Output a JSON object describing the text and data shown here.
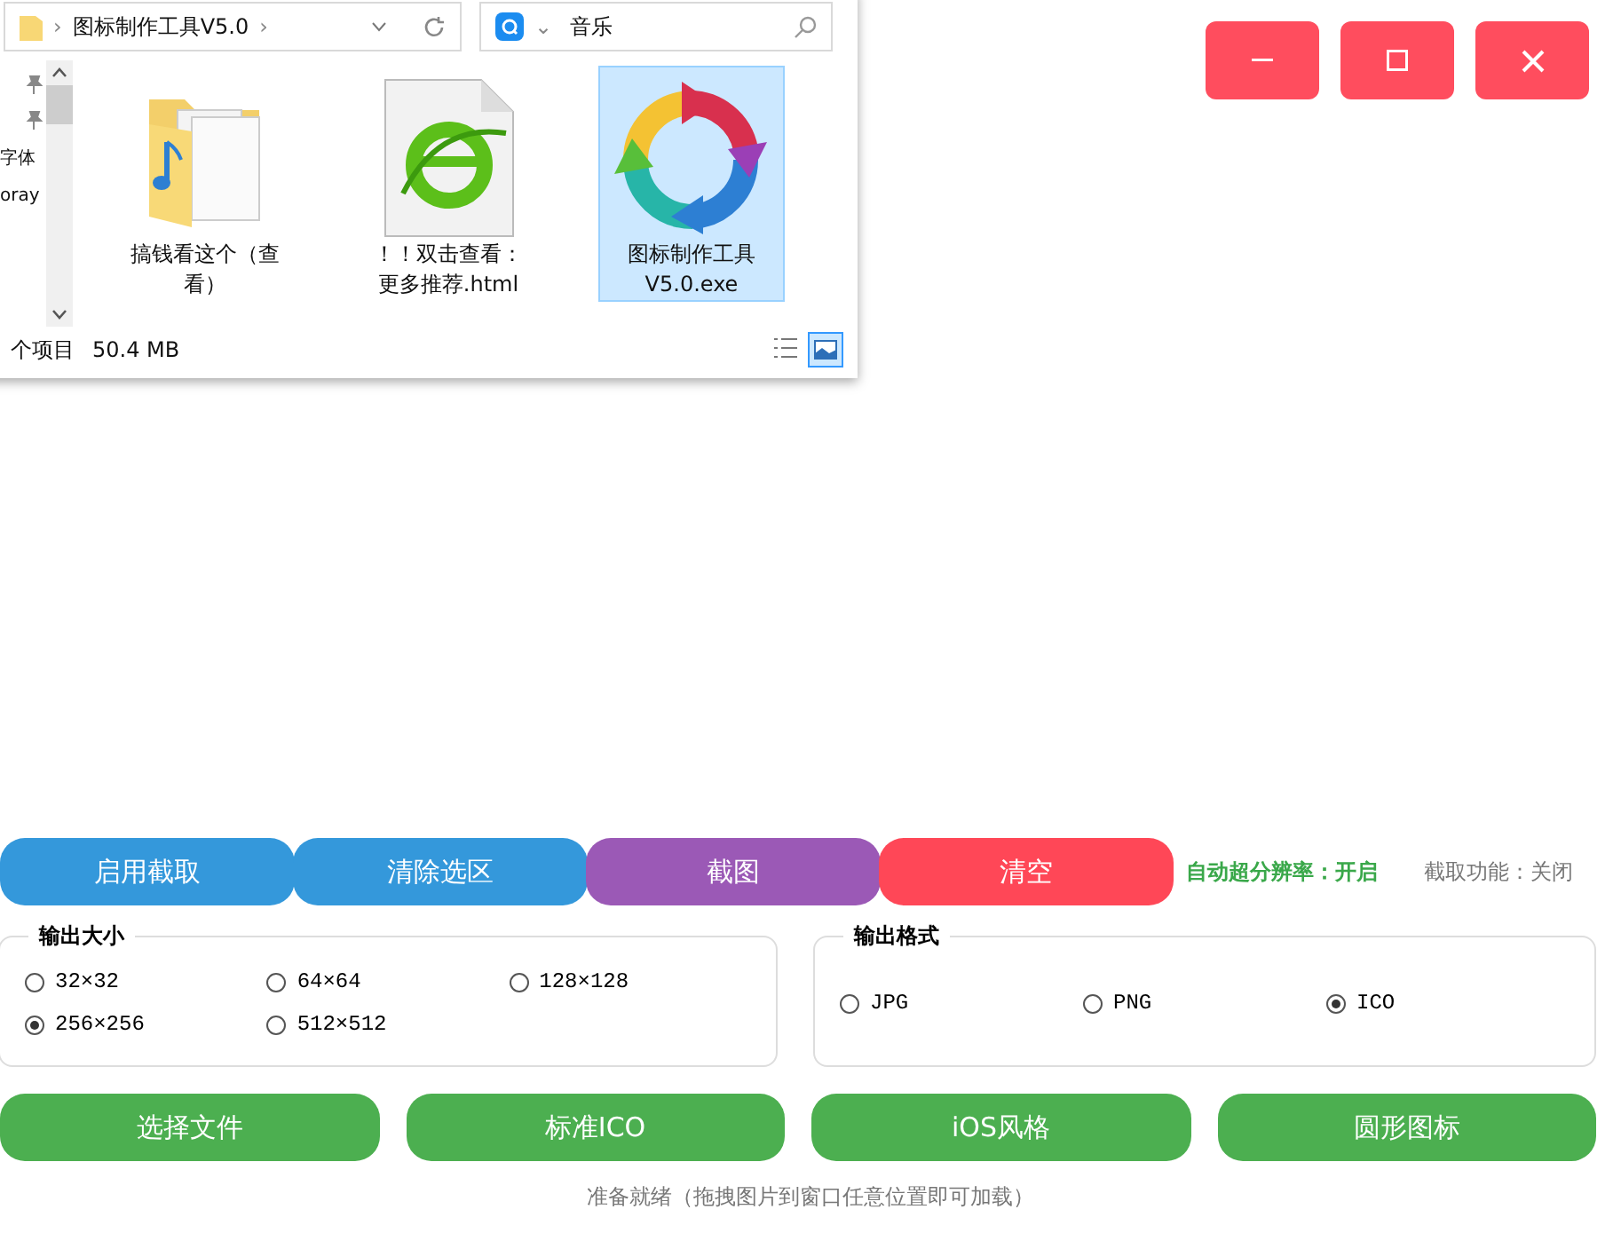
{
  "explorer": {
    "address": {
      "path": "图标制作工具V5.0",
      "separator_before": "›",
      "separator_after": "›"
    },
    "search": {
      "value": "音乐",
      "caret": "⌄"
    },
    "nav_items": [
      {
        "kind": "pin"
      },
      {
        "kind": "pin"
      },
      {
        "kind": "text",
        "label": "字体"
      },
      {
        "kind": "text",
        "label": "oray"
      }
    ],
    "files": [
      {
        "kind": "music-folder",
        "name": "搞钱看这个（查看）",
        "selected": false
      },
      {
        "kind": "web-page",
        "name": "！！双击查看：更多推荐.html",
        "selected": false
      },
      {
        "kind": "program",
        "name": "图标制作工具V5.0.exe",
        "selected": true
      }
    ],
    "status_bar": {
      "count": "个项目",
      "size": "50.4 MB"
    }
  },
  "window_controls": [
    {
      "kind": "minimize"
    },
    {
      "kind": "maximize"
    },
    {
      "kind": "close"
    }
  ],
  "toolbar": {
    "buttons": [
      {
        "label": "启用截取",
        "color": "#3498db"
      },
      {
        "label": "清除选区",
        "color": "#3498db"
      },
      {
        "label": "截图",
        "color": "#9b59b6"
      },
      {
        "label": "清空",
        "color": "#ff4757"
      }
    ],
    "auto_super_resolution": "自动超分辨率：开启",
    "capture_status": "截取功能：关闭"
  },
  "output_size": {
    "title": "输出大小",
    "options": [
      {
        "label": "32×32",
        "selected": false
      },
      {
        "label": "64×64",
        "selected": false
      },
      {
        "label": "128×128",
        "selected": false
      },
      {
        "label": "256×256",
        "selected": true
      },
      {
        "label": "512×512",
        "selected": false
      }
    ]
  },
  "output_format": {
    "title": "输出格式",
    "options": [
      {
        "label": "JPG",
        "selected": false
      },
      {
        "label": "PNG",
        "selected": false
      },
      {
        "label": "ICO",
        "selected": true
      }
    ]
  },
  "actions": [
    "选择文件",
    "标准ICO",
    "iOS风格",
    "圆形图标"
  ],
  "status": "准备就绪（拖拽图片到窗口任意位置即可加载）"
}
